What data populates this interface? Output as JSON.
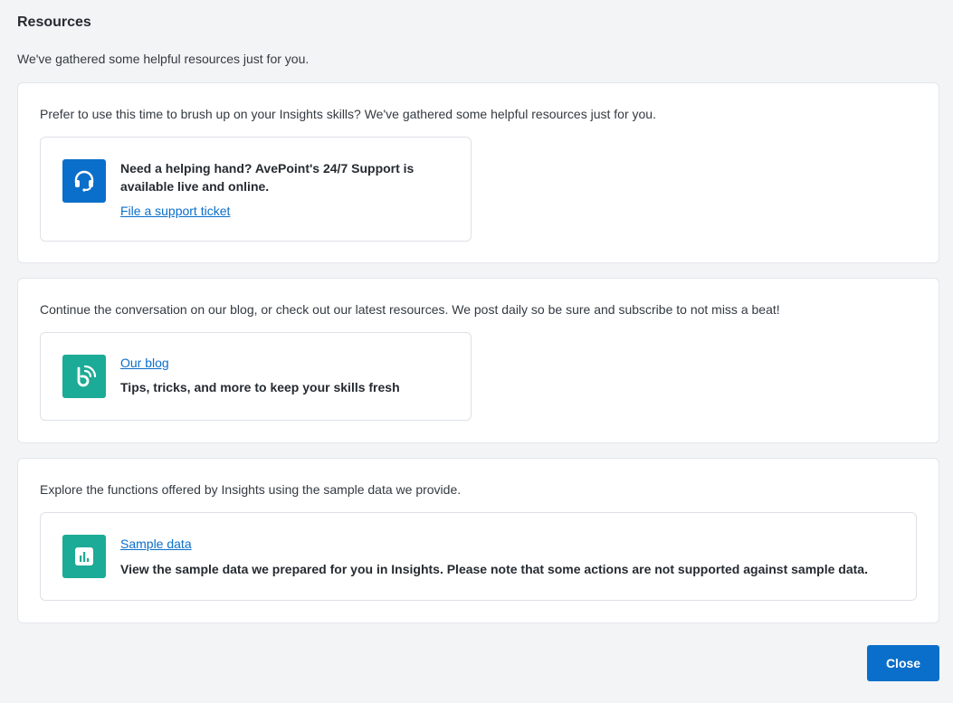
{
  "header": {
    "title": "Resources",
    "subtitle": "We've gathered some helpful resources just for you."
  },
  "sections": [
    {
      "text": "Prefer to use this time to brush up on your Insights skills? We've gathered some helpful resources just for you.",
      "card": {
        "icon": "headset-icon",
        "icon_color": "#0a6fca",
        "text_line1": "Need a helping hand? AvePoint's 24/7 Support is",
        "text_line2": "available live and online.",
        "link": "File a support ticket"
      }
    },
    {
      "text": "Continue the conversation on our blog, or check out our latest resources. We post daily so be sure and subscribe to not miss a beat!",
      "card": {
        "icon": "blog-icon",
        "icon_color": "#1cab96",
        "link": "Our blog",
        "description": "Tips, tricks, and more to keep your skills fresh"
      }
    },
    {
      "text": "Explore the functions offered by Insights using the sample data we provide.",
      "card": {
        "icon": "chart-icon",
        "icon_color": "#1cab96",
        "link": "Sample data",
        "description": "View the sample data we prepared for you in Insights. Please note that some actions are not supported against sample data."
      }
    }
  ],
  "footer": {
    "close_label": "Close",
    "accent": "#0a6fca"
  }
}
